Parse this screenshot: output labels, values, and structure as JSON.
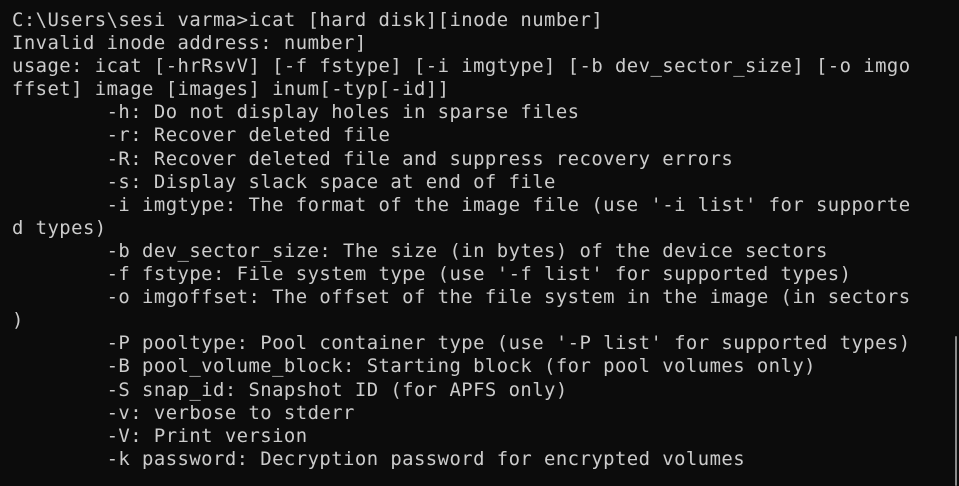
{
  "terminal": {
    "lines": [
      "C:\\Users\\sesi varma>icat [hard disk][inode number]",
      "Invalid inode address: number]",
      "usage: icat [-hrRsvV] [-f fstype] [-i imgtype] [-b dev_sector_size] [-o imgo",
      "ffset] image [images] inum[-typ[-id]]",
      "        -h: Do not display holes in sparse files",
      "        -r: Recover deleted file",
      "        -R: Recover deleted file and suppress recovery errors",
      "        -s: Display slack space at end of file",
      "        -i imgtype: The format of the image file (use '-i list' for supporte",
      "d types)",
      "        -b dev_sector_size: The size (in bytes) of the device sectors",
      "        -f fstype: File system type (use '-f list' for supported types)",
      "        -o imgoffset: The offset of the file system in the image (in sectors",
      ")",
      "        -P pooltype: Pool container type (use '-P list' for supported types)",
      "        -B pool_volume_block: Starting block (for pool volumes only)",
      "        -S snap_id: Snapshot ID (for APFS only)",
      "        -v: verbose to stderr",
      "        -V: Print version",
      "        -k password: Decryption password for encrypted volumes"
    ]
  },
  "colors": {
    "background": "#0c0c0c",
    "foreground": "#cccccc",
    "scrollbar": "#8a8a8a"
  }
}
